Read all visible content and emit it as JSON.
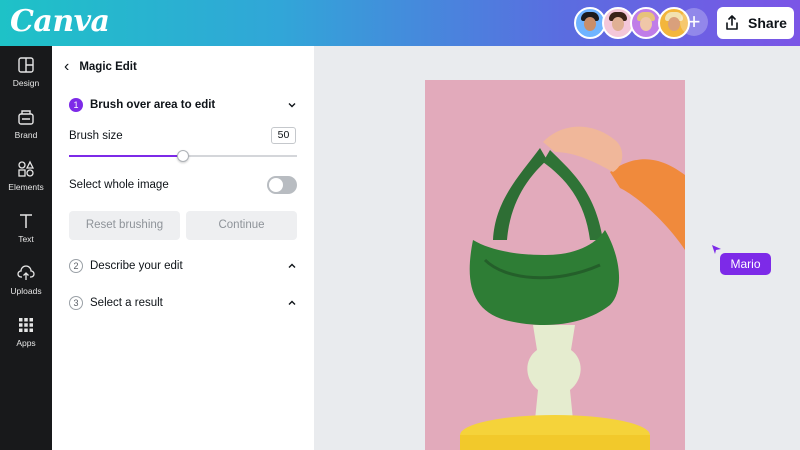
{
  "app": {
    "logo": "Canva",
    "share_label": "Share",
    "add_label": "+"
  },
  "collaborators": [
    {
      "name": "collaborator-1",
      "bg": "#6fb4ff",
      "skin": "#c98e6a",
      "hair": "#1c1c1c"
    },
    {
      "name": "collaborator-2",
      "bg": "#f4c7d9",
      "skin": "#e0b094",
      "hair": "#3a2418"
    },
    {
      "name": "collaborator-3",
      "bg": "#c07de8",
      "skin": "#f0c7a8",
      "hair": "#e7c27a"
    },
    {
      "name": "collaborator-4",
      "bg": "#f3b63c",
      "skin": "#d9a07c",
      "hair": "#f2e2b0"
    }
  ],
  "rail": [
    {
      "label": "Design",
      "icon": "design-icon"
    },
    {
      "label": "Brand",
      "icon": "brand-icon"
    },
    {
      "label": "Elements",
      "icon": "elements-icon"
    },
    {
      "label": "Text",
      "icon": "text-icon"
    },
    {
      "label": "Uploads",
      "icon": "uploads-icon"
    },
    {
      "label": "Apps",
      "icon": "apps-icon"
    }
  ],
  "panel": {
    "title": "Magic Edit",
    "step1": {
      "num": "1",
      "label": "Brush over area to edit"
    },
    "brush_size_label": "Brush size",
    "brush_size_value": "50",
    "brush_slider_fraction": 0.5,
    "select_whole_label": "Select whole image",
    "select_whole_on": false,
    "reset_label": "Reset brushing",
    "continue_label": "Continue",
    "step2": {
      "num": "2",
      "label": "Describe your edit"
    },
    "step3": {
      "num": "3",
      "label": "Select a result"
    }
  },
  "canvas": {
    "cursor_tag": "Mario"
  },
  "colors": {
    "accent": "#7d2ae8",
    "design_bg": "#e2aabb",
    "bag": "#2e7d35"
  }
}
